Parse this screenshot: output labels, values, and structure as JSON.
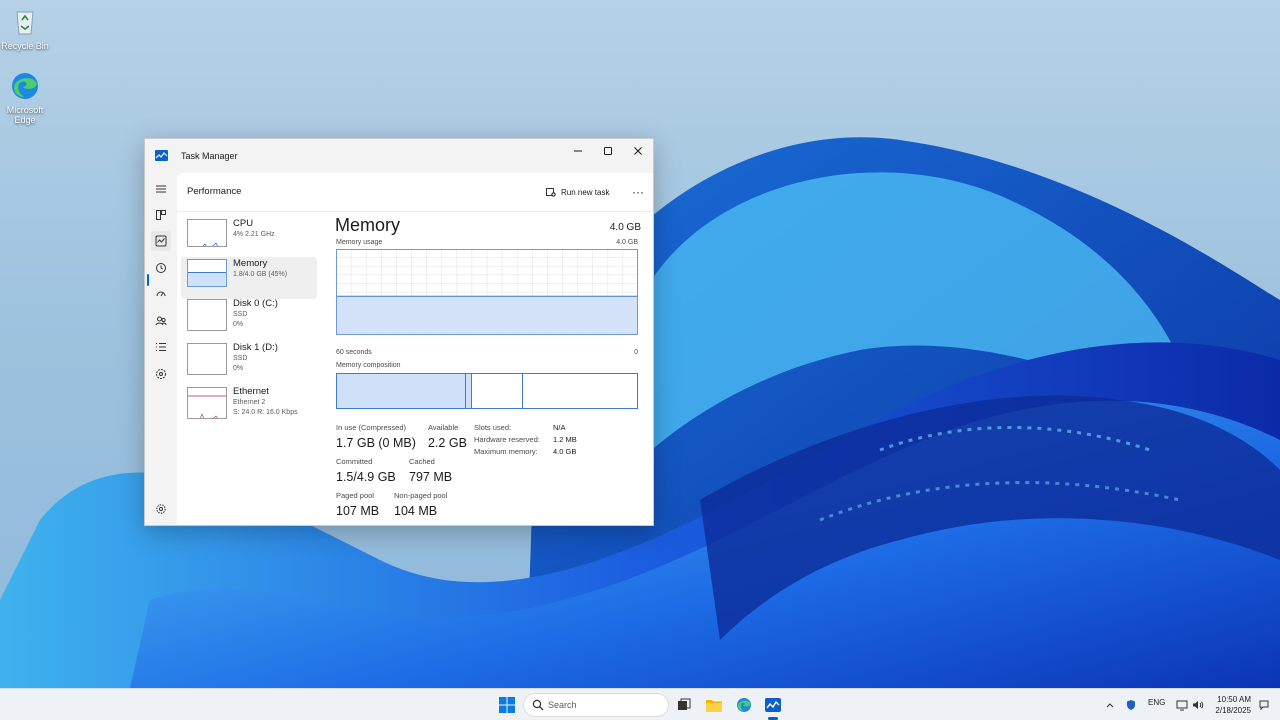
{
  "desktop": {
    "icons": [
      {
        "label": "Recycle Bin",
        "icon": "recycle-bin-icon"
      },
      {
        "label": "Microsoft Edge",
        "icon": "edge-icon"
      }
    ]
  },
  "window": {
    "title": "Task Manager",
    "controls": {
      "minimize": "minimize-icon",
      "maximize": "maximize-icon",
      "close": "close-icon"
    }
  },
  "nav": {
    "items": [
      "hamburger-menu-icon",
      "processes-icon",
      "performance-icon",
      "app-history-icon",
      "startup-apps-icon",
      "users-icon",
      "details-icon",
      "services-icon",
      "settings-icon"
    ],
    "active": "performance"
  },
  "header": {
    "page_title": "Performance",
    "run_new_task": "Run new task",
    "more": "···"
  },
  "resources": [
    {
      "name": "CPU",
      "sub1": "4% 2.21 GHz",
      "sub2": "",
      "sub3": ""
    },
    {
      "name": "Memory",
      "sub1": "1.8/4.0 GB (45%)",
      "sub2": "",
      "sub3": ""
    },
    {
      "name": "Disk 0 (C:)",
      "sub1": "SSD",
      "sub2": "0%",
      "sub3": ""
    },
    {
      "name": "Disk 1 (D:)",
      "sub1": "SSD",
      "sub2": "0%",
      "sub3": ""
    },
    {
      "name": "Ethernet",
      "sub1": "Ethernet 2",
      "sub2": "S: 24.0  R: 16.0 Kbps",
      "sub3": ""
    }
  ],
  "detail": {
    "title": "Memory",
    "total": "4.0 GB",
    "usage_label": "Memory usage",
    "usage_max": "4.0 GB",
    "axis_left": "60 seconds",
    "axis_right": "0",
    "usage_fraction": 0.45,
    "composition_label": "Memory composition",
    "composition": {
      "in_use": 0.43,
      "modified": 0.02,
      "standby": 0.17,
      "free": 0.38
    },
    "stats": {
      "in_use_label": "In use (Compressed)",
      "in_use_value": "1.7 GB (0 MB)",
      "available_label": "Available",
      "available_value": "2.2 GB",
      "committed_label": "Committed",
      "committed_value": "1.5/4.9 GB",
      "cached_label": "Cached",
      "cached_value": "797 MB",
      "paged_label": "Paged pool",
      "paged_value": "107 MB",
      "nonpaged_label": "Non-paged pool",
      "nonpaged_value": "104 MB"
    },
    "kv": {
      "slots_label": "Slots used:",
      "slots_value": "N/A",
      "hw_label": "Hardware reserved:",
      "hw_value": "1.2 MB",
      "max_label": "Maximum memory:",
      "max_value": "4.0 GB"
    }
  },
  "taskbar": {
    "search_placeholder": "Search",
    "tray_lang": "ENG",
    "time": "10:50 AM",
    "date": "2/18/2025"
  },
  "colors": {
    "accent": "#0067c0",
    "memory_fill": "#cfe0f9",
    "memory_line": "#3b7bc8"
  }
}
